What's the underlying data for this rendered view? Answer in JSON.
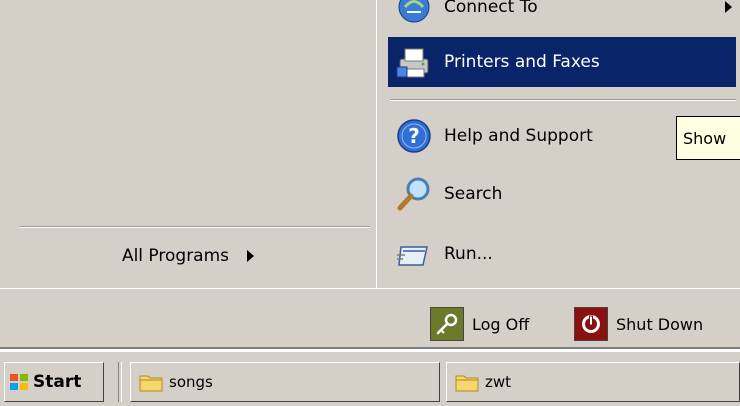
{
  "left_pane": {
    "all_programs_label": "All Programs"
  },
  "right_menu": {
    "items": [
      {
        "label": "Connect To",
        "icon": "connect-icon"
      },
      {
        "label": "Printers and Faxes",
        "icon": "printer-icon",
        "selected": true
      },
      {
        "label": "Help and Support",
        "icon": "help-icon"
      },
      {
        "label": "Search",
        "icon": "search-icon"
      },
      {
        "label": "Run...",
        "icon": "run-icon"
      }
    ]
  },
  "tooltip": {
    "text": "Show"
  },
  "power": {
    "log_off_label": "Log Off",
    "shut_down_label": "Shut Down"
  },
  "taskbar": {
    "start_label": "Start",
    "tasks": [
      {
        "label": "songs",
        "icon": "folder-icon"
      },
      {
        "label": "zwt",
        "icon": "folder-icon"
      }
    ]
  },
  "colors": {
    "menu_bg": "#d4d0c8",
    "selection": "#0a246a",
    "tooltip_bg": "#ffffe1",
    "logoff_icon": "#6b7a2a",
    "shutdown_icon": "#8b1010"
  }
}
